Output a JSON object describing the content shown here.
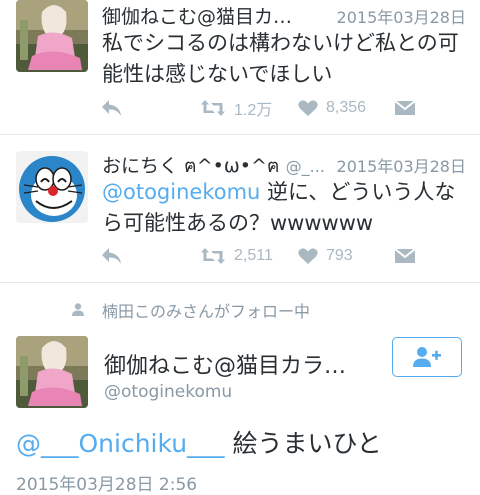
{
  "tweets": [
    {
      "name": "御伽ねこむ@猫目カ…",
      "handle": "",
      "date": "2015年03月28日",
      "text": "私でシコるのは構わないけど私との可能性は感じないでほしい",
      "retweets": "1.2万",
      "likes": "8,356"
    },
    {
      "name": "おにちく ฅ^•ω•^ฅ",
      "handle": "@_...",
      "date": "2015年03月28日",
      "mention": "@otoginekomu",
      "text": " 逆に、どういう人なら可能性あるの？wwwwww",
      "retweets": "2,511",
      "likes": "793"
    }
  ],
  "follow_note": "楠田このみさんがフォロー中",
  "detail": {
    "name": "御伽ねこむ@猫目カラ…",
    "handle": "@otoginekomu",
    "mention": "@___Onichiku___",
    "text": " 絵うまいひと",
    "date": "2015年03月28日 2:56"
  },
  "colors": {
    "accent": "#55acee",
    "icon": "#aab8c2",
    "secondary_text": "#8899a6",
    "divider": "#e1e8ed"
  },
  "icons": {
    "reply": "reply-icon",
    "retweet": "retweet-icon",
    "like": "heart-icon",
    "dm": "envelope-icon",
    "follow": "add-user-icon"
  }
}
